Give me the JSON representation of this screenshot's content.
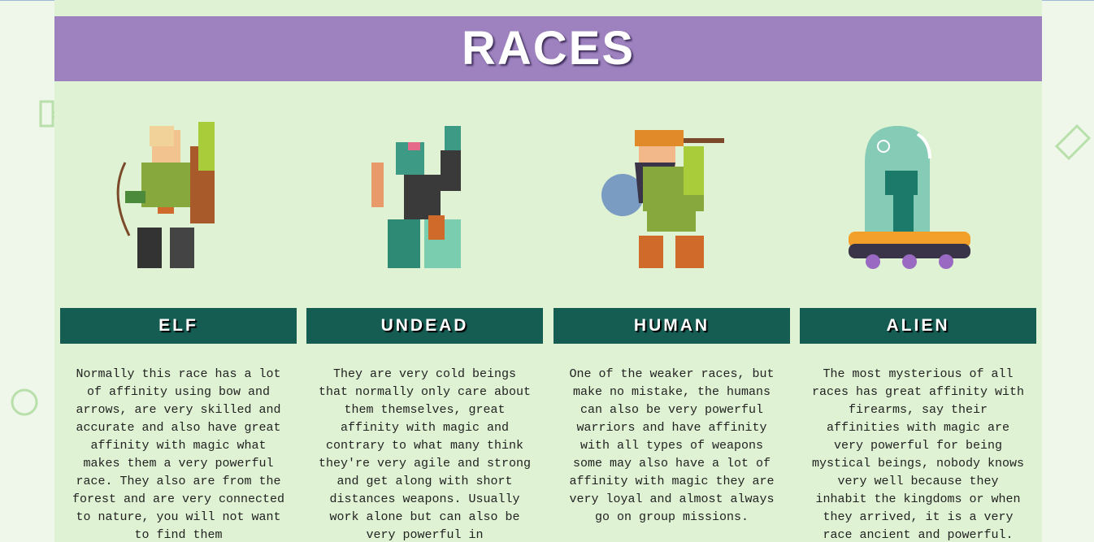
{
  "page": {
    "title": "RACES"
  },
  "races": [
    {
      "name": "ELF",
      "description": "Normally this race has a lot of affinity using bow and arrows, are very skilled and accurate and also have great affinity with magic what makes them a very powerful race. They also are from the forest and are very connected to nature, you will not want to find them"
    },
    {
      "name": "UNDEAD",
      "description": "They are very cold beings that normally only care about them themselves, great affinity with magic and contrary to what many think they're very agile and strong and get along with short distances weapons. Usually work alone but can also be very powerful in"
    },
    {
      "name": "HUMAN",
      "description": "One of the weaker races, but make no mistake, the humans can also be very powerful warriors and have affinity with all types of weapons some may also have a lot of affinity with magic they are very loyal and almost always go on group missions."
    },
    {
      "name": "ALIEN",
      "description": "The most mysterious of all races has great affinity with firearms, say their affinities with magic are very powerful for being mystical beings, nobody knows very well because they inhabit the kingdoms or when they arrived, it is a very race ancient and powerful."
    }
  ],
  "colors": {
    "title_bg": "#9e82bf",
    "card_header_bg": "#155c52",
    "content_bg": "#dff2d3"
  }
}
